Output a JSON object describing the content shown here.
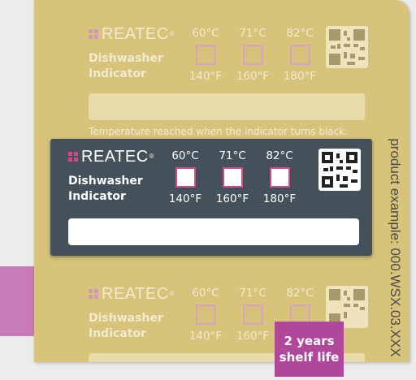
{
  "brand": {
    "name": "REATEC",
    "registered": "®"
  },
  "indicator_title_line1": "Dishwasher",
  "indicator_title_line2": "Indicator",
  "temperatures": [
    {
      "celsius": "60°C",
      "fahrenheit": "140°F"
    },
    {
      "celsius": "71°C",
      "fahrenheit": "160°F"
    },
    {
      "celsius": "82°C",
      "fahrenheit": "180°F"
    }
  ],
  "caption": "Temperature reached when the indicator turns black.",
  "side_text": "product example: 000.WSX.03.XXX",
  "badge": {
    "line1": "2 years",
    "line2": "shelf life"
  },
  "colors": {
    "accent": "#cc4f8f",
    "sheet": "#d7c37a",
    "label": "#44505a",
    "badge": "#b1479b"
  },
  "icons": {
    "logo": "reatec-logo-icon",
    "qr": "qr-code-icon"
  }
}
